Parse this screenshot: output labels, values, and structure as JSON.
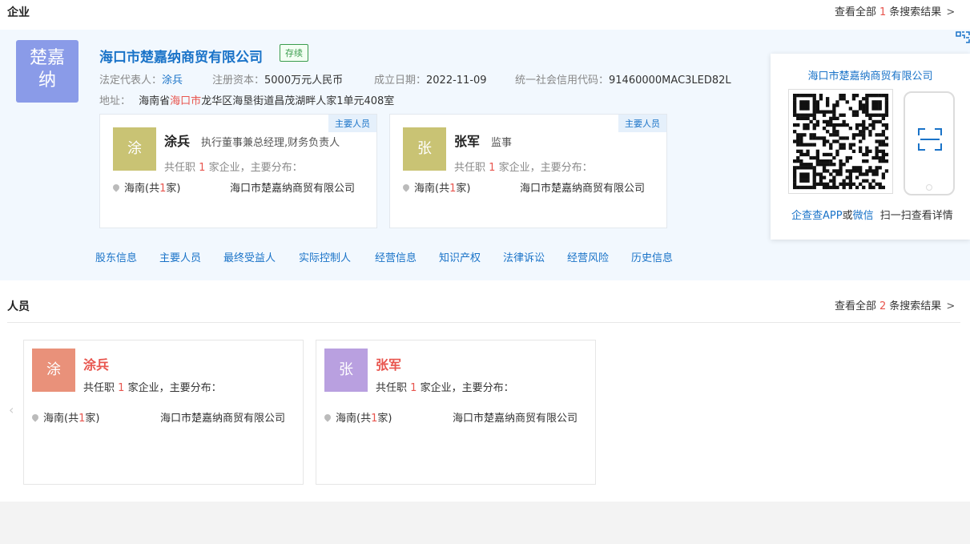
{
  "company_section": {
    "title": "企业",
    "see_all_prefix": "查看全部",
    "see_all_count": "1",
    "see_all_suffix": "条搜索结果",
    "arrow": ">"
  },
  "company": {
    "logo_text": "楚嘉纳",
    "name": "海口市楚嘉纳商贸有限公司",
    "status": "存续",
    "legal_rep_label": "法定代表人：",
    "legal_rep": "涂兵",
    "capital_label": "注册资本：",
    "capital": "5000万元人民币",
    "founded_label": "成立日期：",
    "founded": "2022-11-09",
    "credit_label": "统一社会信用代码：",
    "credit_code": "91460000MAC3LED82L",
    "address_label": "地址：",
    "address_pre": "海南省",
    "address_hl": "海口市",
    "address_post": "龙华区海垦街道昌茂湖畔人家1单元408室"
  },
  "key_people": [
    {
      "tag": "主要人员",
      "avatar": "涂",
      "name": "涂兵",
      "role": "执行董事兼总经理,财务负责人",
      "jobs_pre": "共任职",
      "jobs_count": "1",
      "jobs_post": "家企业，主要分布：",
      "loc_pre": "海南(共",
      "loc_count": "1",
      "loc_post": "家)",
      "company": "海口市楚嘉纳商贸有限公司"
    },
    {
      "tag": "主要人员",
      "avatar": "张",
      "name": "张军",
      "role": "监事",
      "jobs_pre": "共任职",
      "jobs_count": "1",
      "jobs_post": "家企业，主要分布：",
      "loc_pre": "海南(共",
      "loc_count": "1",
      "loc_post": "家)",
      "company": "海口市楚嘉纳商贸有限公司"
    }
  ],
  "nav_links": [
    "股东信息",
    "主要人员",
    "最终受益人",
    "实际控制人",
    "经营信息",
    "知识产权",
    "法律诉讼",
    "经营风险",
    "历史信息"
  ],
  "qr_panel": {
    "title": "海口市楚嘉纳商贸有限公司",
    "app_link": "企查查APP",
    "or": "或",
    "wechat_link": "微信",
    "scan_text": "扫一扫查看详情"
  },
  "people_section": {
    "title": "人员",
    "see_all_prefix": "查看全部",
    "see_all_count": "2",
    "see_all_suffix": "条搜索结果",
    "arrow": ">",
    "prev_arrow": "‹"
  },
  "people": [
    {
      "avatar": "涂",
      "avatar_color": "#e9917a",
      "name": "涂兵",
      "jobs_pre": "共任职",
      "jobs_count": "1",
      "jobs_post": "家企业，主要分布：",
      "loc_pre": "海南(共",
      "loc_count": "1",
      "loc_post": "家)",
      "company": "海口市楚嘉纳商贸有限公司"
    },
    {
      "avatar": "张",
      "avatar_color": "#b9a0e0",
      "name": "张军",
      "jobs_pre": "共任职",
      "jobs_count": "1",
      "jobs_post": "家企业，主要分布：",
      "loc_pre": "海南(共",
      "loc_count": "1",
      "loc_post": "家)",
      "company": "海口市楚嘉纳商贸有限公司"
    }
  ]
}
